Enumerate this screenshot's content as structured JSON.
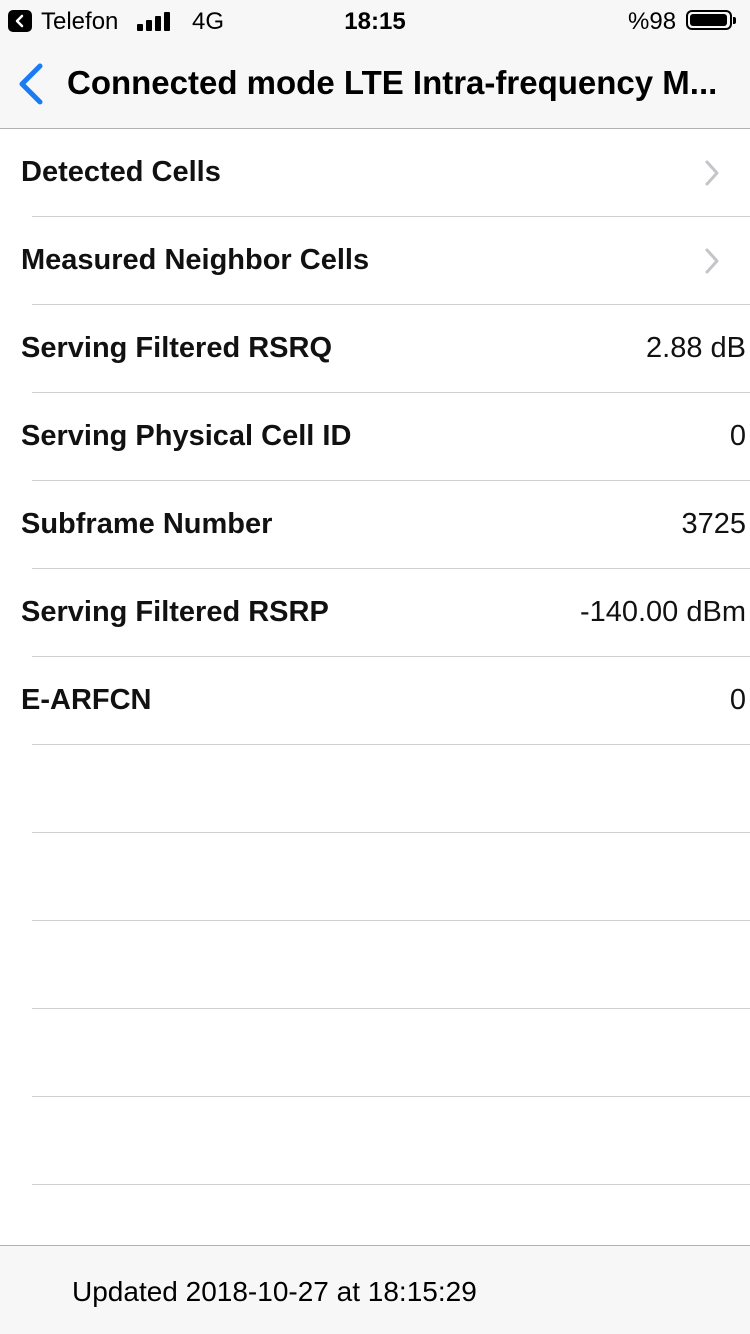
{
  "status_bar": {
    "carrier": "Telefon",
    "network": "4G",
    "time": "18:15",
    "battery": "%98",
    "battery_level": 0.98,
    "signal_bars": 4
  },
  "nav": {
    "title": "Connected mode LTE Intra-frequency M..."
  },
  "rows": [
    {
      "label": "Detected Cells",
      "value": ""
    },
    {
      "label": "Measured Neighbor Cells",
      "value": ""
    },
    {
      "label": "Serving Filtered RSRQ",
      "value": "2.88 dB"
    },
    {
      "label": "Serving Physical Cell ID",
      "value": "0"
    },
    {
      "label": "Subframe Number",
      "value": "3725"
    },
    {
      "label": "Serving Filtered RSRP",
      "value": "-140.00 dBm"
    },
    {
      "label": "E-ARFCN",
      "value": "0"
    }
  ],
  "footer": {
    "updated": "Updated 2018-10-27 at 18:15:29"
  }
}
